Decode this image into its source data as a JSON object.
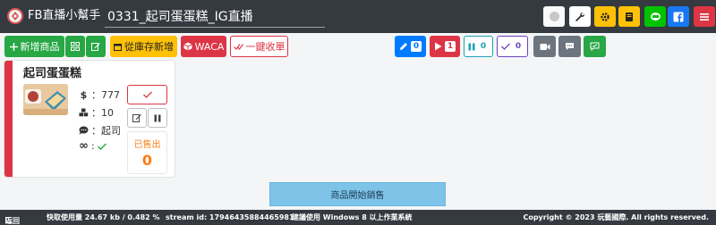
{
  "header": {
    "app_name": "FB直播小幫手",
    "title_value": "0331_起司蛋蛋糕_IG直播",
    "buttons": [
      {
        "name": "circle-button",
        "icon": "circle-icon",
        "bg": "#f8f9fa"
      },
      {
        "name": "wrench-button",
        "icon": "wrench-icon",
        "bg": "#ffffff"
      },
      {
        "name": "settings-button",
        "icon": "gear-icon",
        "bg": "#ffc107"
      },
      {
        "name": "book-button",
        "icon": "book-icon",
        "bg": "#ffc107"
      },
      {
        "name": "line-button",
        "icon": "line-icon",
        "bg": "#00c300"
      },
      {
        "name": "facebook-button",
        "icon": "facebook-icon",
        "bg": "#1877f2"
      },
      {
        "name": "menu-button",
        "icon": "menu-icon",
        "bg": "#dc3545"
      }
    ]
  },
  "toolbar": {
    "add_product": "新增商品",
    "from_inventory": "從庫存新增",
    "waca": "WACA",
    "one_click_close": "一鍵收單",
    "counters": {
      "edit_count": "0",
      "play_count": "1",
      "pause_count": "0",
      "done_count": "0"
    }
  },
  "product": {
    "name": "起司蛋蛋糕",
    "price": "：777",
    "quantity": "：10",
    "keyword": "：起司",
    "sold_label": "已售出",
    "sold_count": "0"
  },
  "toast": {
    "message": "商品開始銷售"
  },
  "footer": {
    "back": "返回",
    "traffic": "快取使用量 24.67 kb / 0.482 %",
    "stream": "stream id: 17946435884465981",
    "advice": "建議使用 Windows 8 以上作業系統",
    "copyright": "Copyright © 2023 玩藝國際. All rights reserved."
  },
  "colors": {
    "header_bg": "#343a40",
    "success": "#28a745",
    "warning": "#ffc107",
    "danger": "#dc3545",
    "primary": "#007bff",
    "info": "#17a2b8",
    "secondary": "#6c757d",
    "sold": "#fd7e14"
  }
}
